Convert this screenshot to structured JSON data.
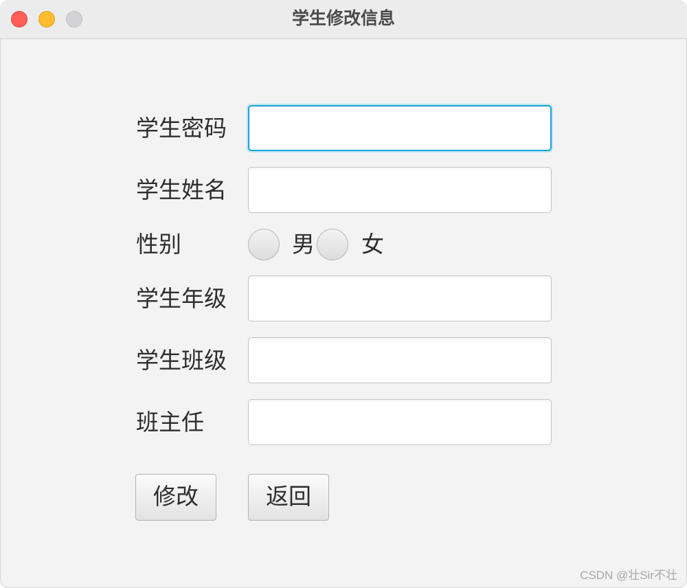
{
  "window": {
    "title": "学生修改信息"
  },
  "form": {
    "password_label": "学生密码",
    "password_value": "",
    "name_label": "学生姓名",
    "name_value": "",
    "gender_label": "性别",
    "gender_options": [
      "男",
      "女"
    ],
    "grade_label": "学生年级",
    "grade_value": "",
    "class_label": "学生班级",
    "class_value": "",
    "teacher_label": "班主任",
    "teacher_value": ""
  },
  "buttons": {
    "modify_label": "修改",
    "back_label": "返回"
  },
  "watermark": "CSDN @壮Sir不壮",
  "colors": {
    "focus_ring": "#1aa4d6",
    "close": "#fe5f57",
    "minimize": "#febc2e",
    "maximize": "#d3d3d5"
  }
}
